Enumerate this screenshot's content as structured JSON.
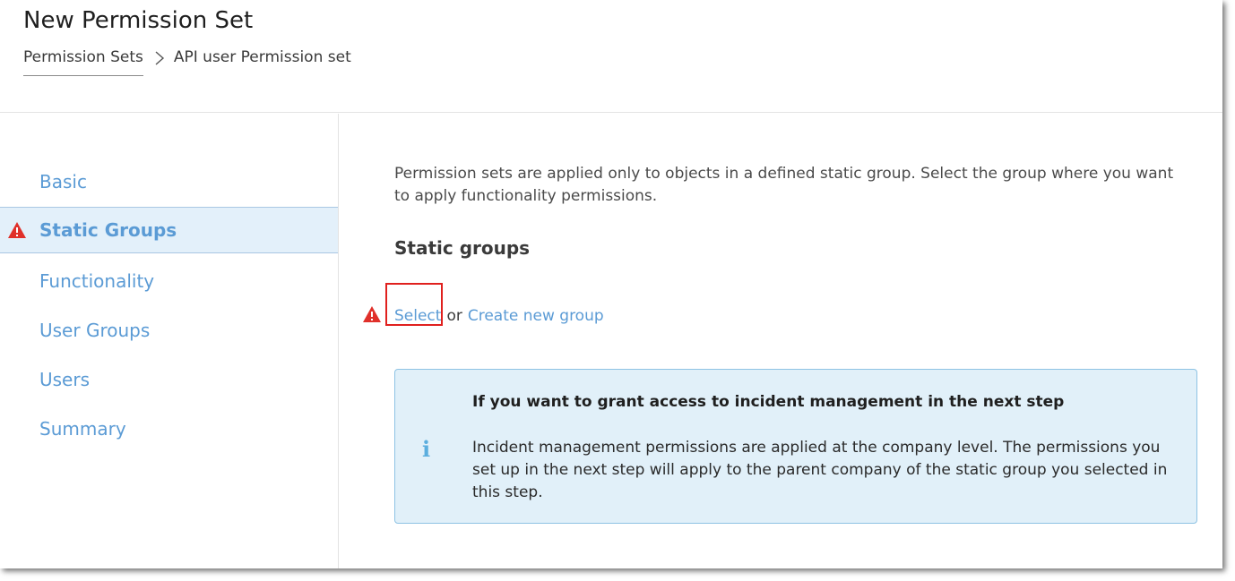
{
  "page": {
    "title": "New Permission Set"
  },
  "breadcrumb": {
    "parent": "Permission Sets",
    "current": "API user Permission set"
  },
  "sidebar": {
    "items": [
      {
        "label": "Basic",
        "active": false,
        "warning": false
      },
      {
        "label": "Static Groups",
        "active": true,
        "warning": true
      },
      {
        "label": "Functionality",
        "active": false,
        "warning": false
      },
      {
        "label": "User Groups",
        "active": false,
        "warning": false
      },
      {
        "label": "Users",
        "active": false,
        "warning": false
      },
      {
        "label": "Summary",
        "active": false,
        "warning": false
      }
    ]
  },
  "main": {
    "intro": "Permission sets are applied only to objects in a defined static group. Select the group where you want to apply functionality permissions.",
    "section_title": "Static groups",
    "select_link": "Select",
    "or_text": "or",
    "create_link": "Create new group",
    "info": {
      "icon": "info-icon",
      "glyph": "i",
      "title": "If you want to grant access to incident management in the next step",
      "body": "Incident management permissions are applied at the company level. The permissions you set up in the next step will apply to the parent company of the static group you selected in this step."
    }
  },
  "colors": {
    "link": "#5b9bd5",
    "active_bg": "#e3f0fa",
    "warning": "#e0302a",
    "highlight": "#e0201e",
    "info_bg": "#e1f0f9",
    "info_border": "#8ec3e4"
  }
}
